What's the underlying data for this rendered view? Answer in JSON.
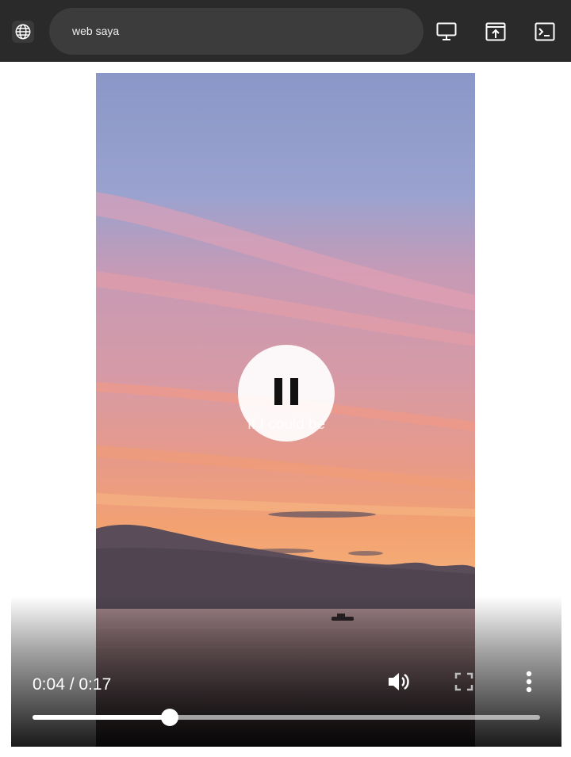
{
  "browser": {
    "address_text": "web saya",
    "icons": [
      "globe-icon",
      "desktop-icon",
      "open-in-new-icon",
      "terminal-icon"
    ]
  },
  "video": {
    "subtitle": "If I could be",
    "current_time": "0:04",
    "duration": "0:17",
    "time_display": "0:04 / 0:17",
    "progress_fraction": 0.27,
    "play_state": "playing",
    "icons": [
      "pause-icon",
      "volume-icon",
      "fullscreen-icon",
      "more-options-icon"
    ]
  },
  "colors": {
    "toolbar": "#2a2a2a",
    "address_bar": "#3c3c3c",
    "page_background": "#ffffff"
  }
}
